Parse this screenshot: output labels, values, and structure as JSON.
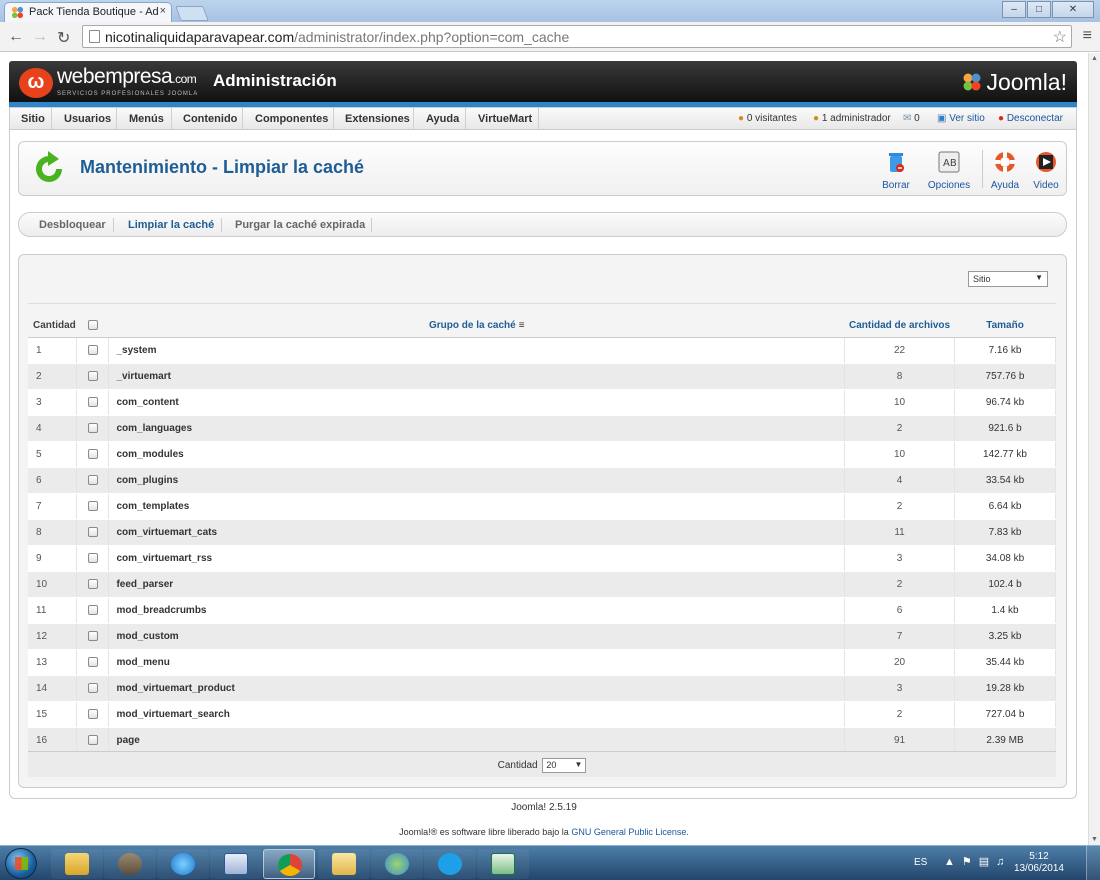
{
  "browser": {
    "tab_title": "Pack Tienda Boutique - Ad",
    "tab_close": "×",
    "url_host": "nicotinaliquidaparavapear.com",
    "url_path": "/administrator/index.php?option=com_cache",
    "window_buttons": {
      "minimize": "–",
      "maximize": "□",
      "close": "✕"
    }
  },
  "header": {
    "brand": "webempresa",
    "brand_suffix": ".com",
    "tagline": "SERVICIOS PROFESIONALES JOOMLA",
    "admin_title": "Administración",
    "joomla_logo": "Joomla!",
    "colors": {
      "accent_bar": "#2c86c9",
      "title": "#1f5d95",
      "link": "#1b57a0"
    }
  },
  "menubar": {
    "items": [
      "Sitio",
      "Usuarios",
      "Menús",
      "Contenido",
      "Componentes",
      "Extensiones",
      "Ayuda",
      "VirtueMart"
    ],
    "status": {
      "visitors": "0 visitantes",
      "admins": "1 administrador",
      "messages": "0",
      "view_site": "Ver sitio",
      "logout": "Desconectar"
    }
  },
  "toolbar": {
    "page_title": "Mantenimiento - Limpiar la caché",
    "buttons": {
      "delete": "Borrar",
      "options": "Opciones",
      "help": "Ayuda",
      "video": "Video"
    }
  },
  "submenu": {
    "items": [
      "Desbloquear",
      "Limpiar la caché",
      "Purgar la caché expirada"
    ],
    "active": "Limpiar la caché"
  },
  "filter": {
    "client_selected": "Sitio"
  },
  "table": {
    "headers": {
      "count": "Cantidad",
      "group": "Grupo de la caché",
      "files": "Cantidad de archivos",
      "size": "Tamaño"
    },
    "rows": [
      {
        "num": "1",
        "group": "_system",
        "files": "22",
        "size": "7.16 kb"
      },
      {
        "num": "2",
        "group": "_virtuemart",
        "files": "8",
        "size": "757.76 b"
      },
      {
        "num": "3",
        "group": "com_content",
        "files": "10",
        "size": "96.74 kb"
      },
      {
        "num": "4",
        "group": "com_languages",
        "files": "2",
        "size": "921.6 b"
      },
      {
        "num": "5",
        "group": "com_modules",
        "files": "10",
        "size": "142.77 kb"
      },
      {
        "num": "6",
        "group": "com_plugins",
        "files": "4",
        "size": "33.54 kb"
      },
      {
        "num": "7",
        "group": "com_templates",
        "files": "2",
        "size": "6.64 kb"
      },
      {
        "num": "8",
        "group": "com_virtuemart_cats",
        "files": "11",
        "size": "7.83 kb"
      },
      {
        "num": "9",
        "group": "com_virtuemart_rss",
        "files": "3",
        "size": "34.08 kb"
      },
      {
        "num": "10",
        "group": "feed_parser",
        "files": "2",
        "size": "102.4 b"
      },
      {
        "num": "11",
        "group": "mod_breadcrumbs",
        "files": "6",
        "size": "1.4 kb"
      },
      {
        "num": "12",
        "group": "mod_custom",
        "files": "7",
        "size": "3.25 kb"
      },
      {
        "num": "13",
        "group": "mod_menu",
        "files": "20",
        "size": "35.44 kb"
      },
      {
        "num": "14",
        "group": "mod_virtuemart_product",
        "files": "3",
        "size": "19.28 kb"
      },
      {
        "num": "15",
        "group": "mod_virtuemart_search",
        "files": "2",
        "size": "727.04 b"
      },
      {
        "num": "16",
        "group": "page",
        "files": "91",
        "size": "2.39 MB"
      }
    ]
  },
  "pager": {
    "label": "Cantidad",
    "limit": "20"
  },
  "footer": {
    "version": "Joomla! 2.5.19",
    "license_prefix": "Joomla!® es software libre liberado bajo la",
    "license_link": "GNU General Public License",
    "license_suffix": "."
  },
  "taskbar": {
    "lang": "ES",
    "time": "5:12",
    "date": "13/06/2014",
    "apps": [
      "windows-explorer",
      "gimp",
      "internet-explorer",
      "word",
      "chrome",
      "explorer-folders",
      "people",
      "skype",
      "excel"
    ]
  }
}
